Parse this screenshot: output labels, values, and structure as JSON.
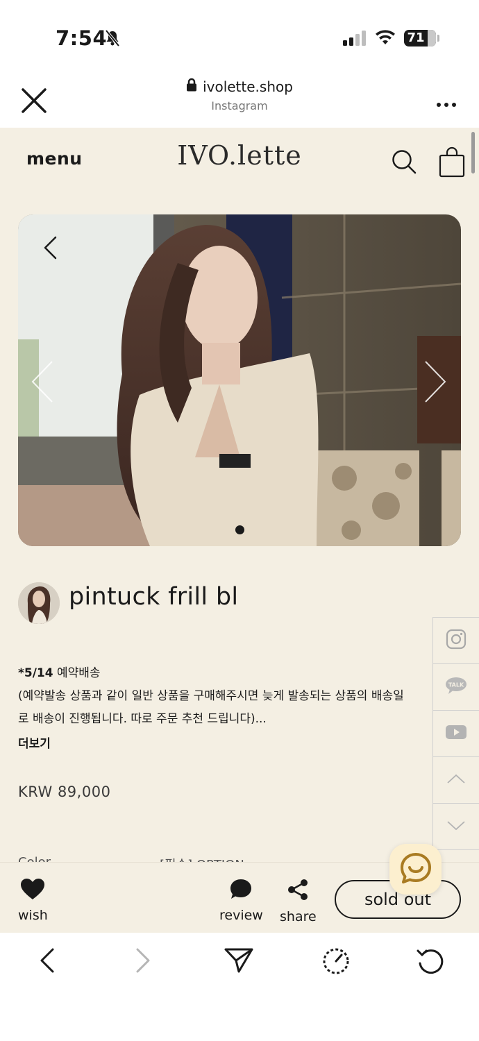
{
  "status_bar": {
    "time": "7:54",
    "battery": "71"
  },
  "browser": {
    "url": "ivolette.shop",
    "source": "Instagram"
  },
  "site": {
    "menu_label": "menu",
    "logo": "IVO.lette"
  },
  "product": {
    "title": "pintuck frill bl",
    "desc_head": "*5/14",
    "desc_head_rest": " 예약배송",
    "desc_line2": "(예약발송 상품과 같이 일반 상품을 구매해주시면 늦게 발송되는 상품의 배송일",
    "desc_line3": "로 배송이 진행됩니다. 따로 주문 추천 드립니다)...",
    "more_label": "더보기",
    "price": "KRW 89,000",
    "option_label": "Color",
    "option_value": "[필수] OPTION"
  },
  "side_rail": {
    "talk_label": "TALK"
  },
  "actions": {
    "wish": "wish",
    "review": "review",
    "share": "share",
    "sold_out": "sold out"
  },
  "colors": {
    "page_bg": "#f4efe3",
    "chat_bg": "#fcefcf",
    "chat_accent": "#a97b22"
  },
  "icons": [
    "bell-slash-icon",
    "signal-icon",
    "wifi-icon",
    "close-icon",
    "lock-icon",
    "more-icon",
    "search-icon",
    "bag-icon",
    "chevron-left-icon",
    "instagram-icon",
    "kakao-talk-icon",
    "youtube-icon",
    "chevron-up-icon",
    "chevron-down-icon",
    "heart-icon",
    "chat-bubble-icon",
    "share-icon",
    "chat-smile-icon",
    "back-icon",
    "forward-icon",
    "send-icon",
    "timer-icon",
    "reload-icon"
  ]
}
